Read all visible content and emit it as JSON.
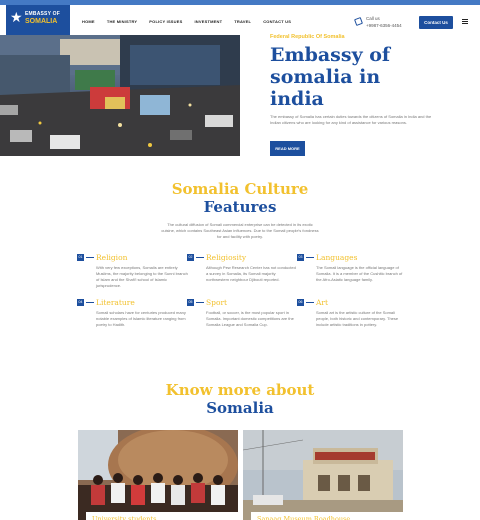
{
  "header": {
    "logo_line1": "EMBASSY OF",
    "logo_line2": "SOMALIA",
    "nav": [
      "HOME",
      "THE MINISTRY",
      "POLICY ISSUES",
      "INVESTMENT",
      "TRAVEL",
      "CONTACT US"
    ],
    "call_label": "Call us",
    "call_number": "+9987-6356-4454",
    "contact_button": "Contact Us"
  },
  "hero": {
    "eyebrow": "Federal Republic Of Somalia",
    "title": "Embassy of somalia in india",
    "description": "The embassy of Somalia has certain duties towards the citizens of Somalia in India and the Indian citizens who are looking for any kind of assistance for various reasons.",
    "button": "READ MORE"
  },
  "culture": {
    "title_top": "Somalia Culture",
    "title_bottom": "Features",
    "description": "The cultural diffusion of Somali commercial enterprise can be detected in its exotic cuisine, which contains Southeast Asian influences. Due to the Somali people's fondness for and facility with poetry.",
    "features": [
      {
        "num": "01",
        "title": "Religion",
        "text": "With very few exceptions, Somalis are entirely Muslims, the majority belonging to the Sunni branch of Islam and the Shafi'i school of Islamic jurisprudence."
      },
      {
        "num": "02",
        "title": "Religiosity",
        "text": "Although Pew Research Center has not conducted a survey in Somalia, its Somali majority northwestern neighbour Djibouti reported."
      },
      {
        "num": "03",
        "title": "Languages",
        "text": "The Somali language is the official language of Somalia. It is a member of the Cushitic branch of the Afro-Asiatic language family."
      },
      {
        "num": "04",
        "title": "Literature",
        "text": "Somali scholars have for centuries produced many notable examples of Islamic literature ranging from poetry to Hadith."
      },
      {
        "num": "05",
        "title": "Sport",
        "text": "Football, or soccer, is the most popular sport in Somalia. Important domestic competitions are the Somalia League and Somalia Cup."
      },
      {
        "num": "06",
        "title": "Art",
        "text": "Somali art is the artistic culture of the Somali people, both historic and contemporary. These include artistic traditions in pottery."
      }
    ]
  },
  "know_more": {
    "title_top": "Know more about",
    "title_bottom": "Somalia",
    "cards": [
      {
        "caption": "University students"
      },
      {
        "caption": "Sanaag Museum Roadhouse"
      }
    ]
  },
  "colors": {
    "primary_blue": "#1d4f9e",
    "accent_yellow": "#f2c12e",
    "top_bar": "#4479c4"
  },
  "icons": {
    "logo": "star-icon",
    "phone": "phone-icon",
    "menu": "hamburger-menu-icon"
  }
}
